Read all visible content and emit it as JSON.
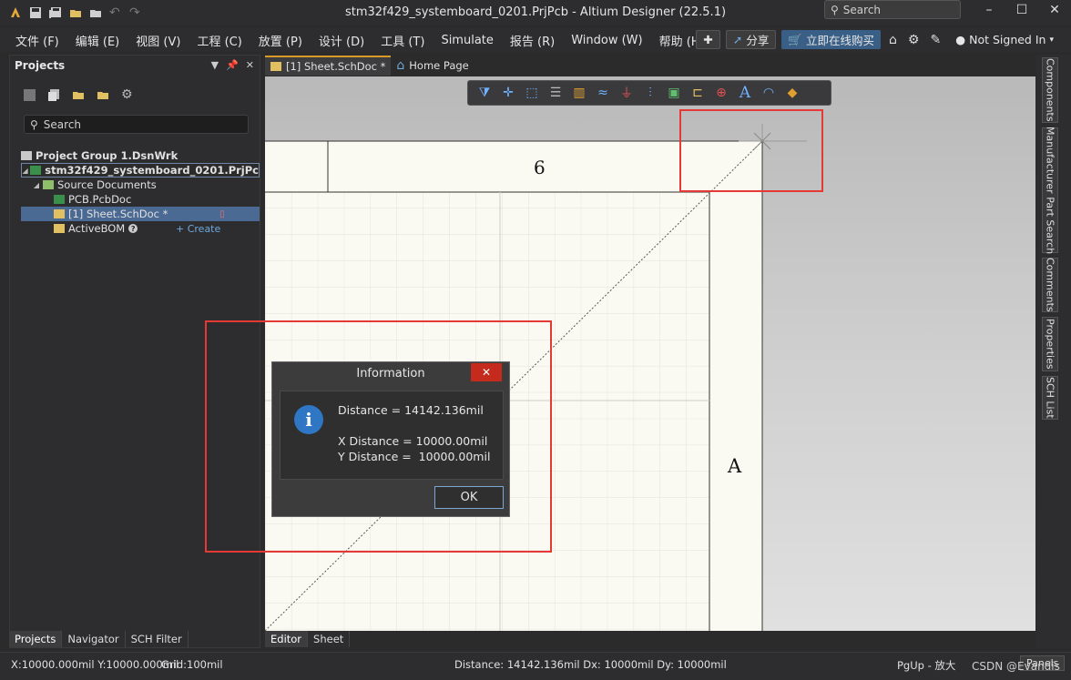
{
  "window": {
    "title": "stm32f429_systemboard_0201.PrjPcb - Altium Designer (22.5.1)",
    "search_placeholder": "Search",
    "controls": [
      "–",
      "☐",
      "✕"
    ]
  },
  "menu": {
    "items": [
      "文件 (F)",
      "编辑 (E)",
      "视图 (V)",
      "工程 (C)",
      "放置 (P)",
      "设计 (D)",
      "工具 (T)",
      "Simulate",
      "报告 (R)",
      "Window (W)",
      "帮助 (H)"
    ],
    "share_label": "分享",
    "buy_label": "立即在线购买",
    "account_label": "Not Signed In"
  },
  "projects_panel": {
    "title": "Projects",
    "search_placeholder": "Search",
    "tree": {
      "group": "Project Group 1.DsnWrk",
      "project": "stm32f429_systemboard_0201.PrjPc",
      "folder": "Source Documents",
      "pcb": "PCB.PcbDoc",
      "sheet": "[1] Sheet.SchDoc *",
      "bom": "ActiveBOM",
      "create": "+ Create"
    },
    "tabs": [
      "Projects",
      "Navigator",
      "SCH Filter"
    ]
  },
  "doc_tabs": [
    "[1] Sheet.SchDoc *",
    "Home Page"
  ],
  "sheet": {
    "zone_number": "6",
    "zone_letter": "A"
  },
  "dialog": {
    "title": "Information",
    "distance": "Distance = 14142.136mil",
    "x_distance": "X Distance = 10000.00mil",
    "y_distance": "Y Distance =  10000.00mil",
    "ok_label": "OK"
  },
  "right_panels": [
    "Components",
    "Manufacturer Part Search",
    "Comments",
    "Properties",
    "SCH List"
  ],
  "editor_tabs": [
    "Editor",
    "Sheet"
  ],
  "status": {
    "coords": "X:10000.000mil Y:10000.000mil",
    "grid": "Grid:100mil",
    "measure": "Distance: 14142.136mil Dx: 10000mil Dy: 10000mil",
    "zoom": "PgUp - 放大",
    "panels_label": "Panels",
    "watermark": "CSDN @Evandis"
  },
  "colors": {
    "accent_tab": "#d99a2b",
    "highlight_red": "#e53935",
    "info_blue": "#2f76c4",
    "selected_row": "#4a6a93"
  }
}
